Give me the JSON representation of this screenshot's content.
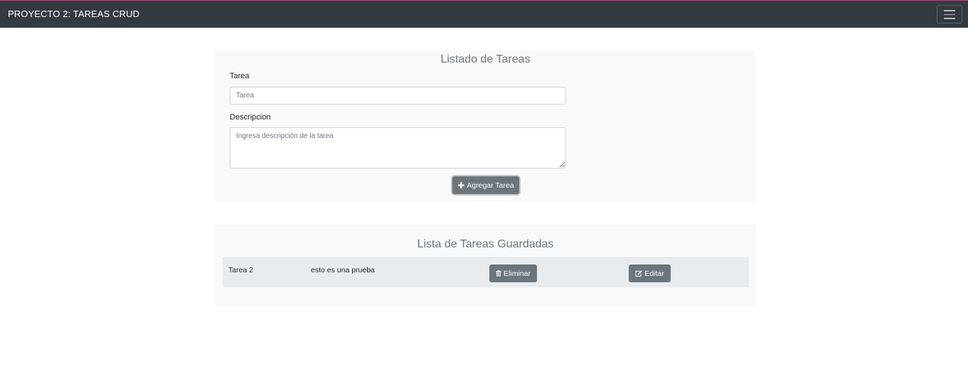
{
  "navbar": {
    "brand": "PROYECTO 2: TAREAS CRUD",
    "toggler_icon": "hamburger-menu-icon",
    "bg_color": "#343a40"
  },
  "form": {
    "title": "Listado de Tareas",
    "task_label": "Tarea",
    "task_placeholder": "Tarea",
    "description_label": "Descripcion",
    "description_placeholder": "Ingresa descripción de la tarea",
    "add_button_label": "Agregar Tarea",
    "add_button_icon": "plus-icon"
  },
  "saved": {
    "title": "Lista de Tareas Guardadas",
    "rows": [
      {
        "task": "Tarea 2",
        "description": "esto es una prueba",
        "delete_label": "Eliminar",
        "delete_icon": "trash-icon",
        "edit_label": "Editar",
        "edit_icon": "edit-icon"
      }
    ]
  },
  "colors": {
    "button": "#6c757d",
    "card_bg": "#f8f9fa",
    "row_bg": "#e9ecef"
  }
}
